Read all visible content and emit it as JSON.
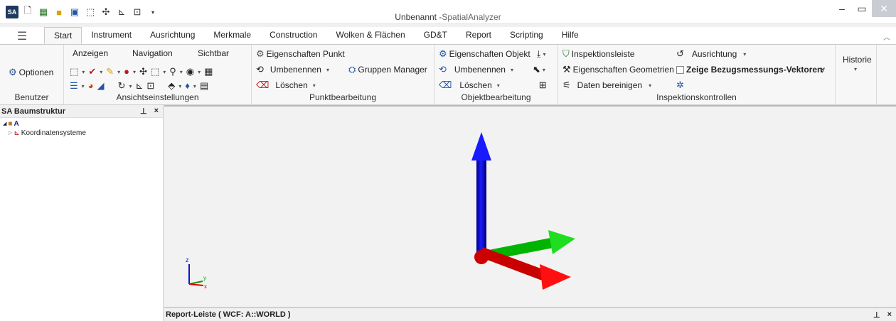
{
  "window": {
    "title_doc": "Unbenannt -",
    "title_app": "SpatialAnalyzer",
    "qat_logo": "SA"
  },
  "tabs": [
    "Start",
    "Instrument",
    "Ausrichtung",
    "Merkmale",
    "Construction",
    "Wolken & Flächen",
    "GD&T",
    "Report",
    "Scripting",
    "Hilfe"
  ],
  "groups": {
    "benutzer": {
      "label": "Benutzer",
      "optionen": "Optionen"
    },
    "ansicht": {
      "label": "Ansichtseinstellungen",
      "anzeigen": "Anzeigen",
      "navigation": "Navigation",
      "sichtbar": "Sichtbar"
    },
    "punkt": {
      "label": "Punktbearbeitung",
      "eigenschaften": "Eigenschaften Punkt",
      "umbenennen": "Umbenennen",
      "gruppen": "Gruppen Manager",
      "loeschen": "Löschen"
    },
    "objekt": {
      "label": "Objektbearbeitung",
      "eigenschaften": "Eigenschaften Objekt",
      "umbenennen": "Umbenennen",
      "loeschen": "Löschen"
    },
    "inspektion": {
      "label": "Inspektionskontrollen",
      "leiste": "Inspektionsleiste",
      "ausrichtung": "Ausrichtung",
      "geometrien": "Eigenschaften Geometrien",
      "vektoren": "Zeige Bezugsmessungs-Vektoren",
      "bereinigen": "Daten bereinigen"
    },
    "historie": {
      "label": "Historie"
    }
  },
  "tree_panel": {
    "title": "SA Baumstruktur",
    "root": "A",
    "child": "Koordinatensysteme"
  },
  "report_bar": {
    "title": "Report-Leiste ( WCF: A::WORLD )"
  },
  "axis_colors": {
    "x": "#e00000",
    "y": "#00c000",
    "z": "#1010e0"
  }
}
